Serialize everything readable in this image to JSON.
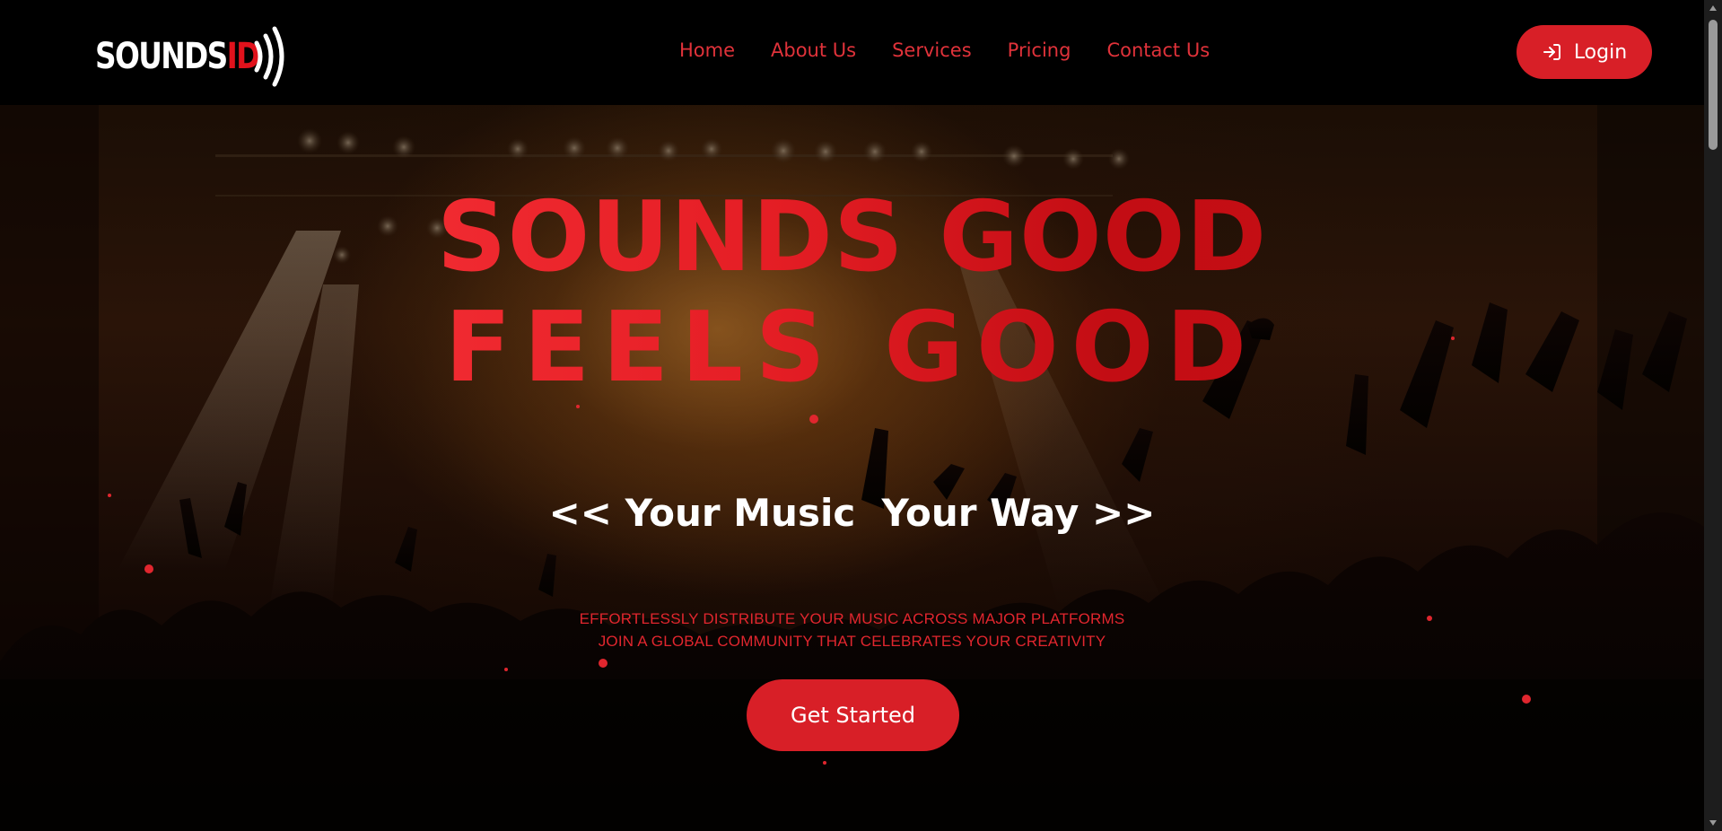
{
  "brand": {
    "name_main": "SOUNDS",
    "name_accent": "ID",
    "logo_icon": "sound-waves-icon",
    "accent_color": "#d81f27"
  },
  "nav": {
    "items": [
      {
        "label": "Home"
      },
      {
        "label": "About Us"
      },
      {
        "label": "Services"
      },
      {
        "label": "Pricing"
      },
      {
        "label": "Contact Us"
      }
    ],
    "login": {
      "label": "Login",
      "icon": "login-arrow-icon"
    }
  },
  "hero": {
    "headline_line1": "SOUNDS GOOD",
    "headline_line2": "FEELS GOOD",
    "tagline": "<< Your Music  Your Way >>",
    "subtext_line1": "EFFORTLESSLY DISTRIBUTE YOUR MUSIC ACROSS MAJOR PLATFORMS",
    "subtext_line2": "JOIN A GLOBAL COMMUNITY THAT CELEBRATES YOUR CREATIVITY",
    "cta_label": "Get Started"
  }
}
